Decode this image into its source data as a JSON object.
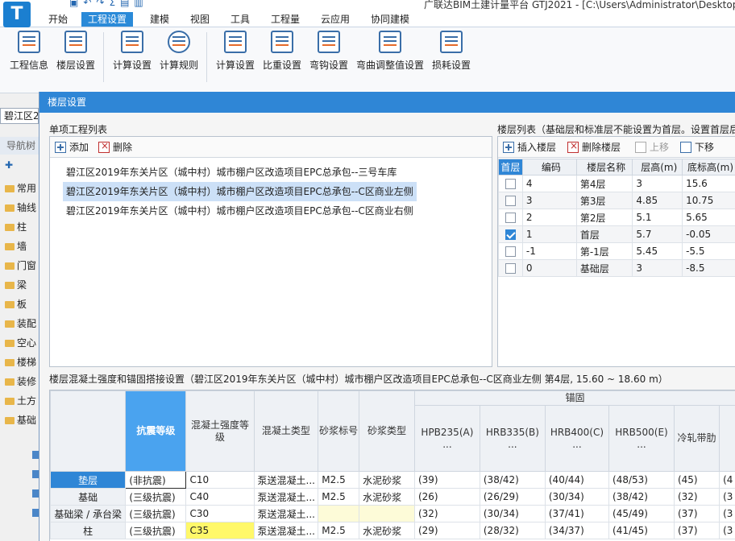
{
  "app": {
    "logo": "T",
    "title": "广联达BIM土建计量平台 GTJ2021 - [C:\\Users\\Administrator\\Desktop"
  },
  "menu": {
    "tabs": [
      "开始",
      "工程设置",
      "建模",
      "视图",
      "工具",
      "工程量",
      "云应用",
      "协同建模"
    ]
  },
  "ribbon": {
    "buttons": [
      "工程信息",
      "楼层设置",
      "计算设置",
      "计算规则",
      "计算设置",
      "比重设置",
      "弯钩设置",
      "弯曲调整值设置",
      "损耗设置"
    ]
  },
  "main": {
    "project_select": "碧江区2",
    "nav_title": "导航树",
    "nav_items": [
      "常用",
      "轴线",
      "柱",
      "墙",
      "门窗",
      "梁",
      "板",
      "装配",
      "空心",
      "楼梯",
      "装修",
      "土方",
      "基础"
    ]
  },
  "dialog": {
    "title": "楼层设置",
    "project_list_label": "单项工程列表",
    "add_label": "添加",
    "delete_label": "删除",
    "projects": [
      "碧江区2019年东关片区（城中村）城市棚户区改造项目EPC总承包--三号车库",
      "碧江区2019年东关片区（城中村）城市棚户区改造项目EPC总承包--C区商业左侧",
      "碧江区2019年东关片区（城中村）城市棚户区改造项目EPC总承包--C区商业右侧"
    ],
    "floor_list_label": "楼层列表（基础层和标准层不能设置为首层。设置首层后",
    "floor_toolbar": {
      "insert": "插入楼层",
      "delete": "删除楼层",
      "up": "上移",
      "down": "下移"
    },
    "floor_headers": [
      "首层",
      "编码",
      "楼层名称",
      "层高(m)",
      "底标高(m)"
    ],
    "floors": [
      {
        "checked": false,
        "code": "4",
        "name": "第4层",
        "height": "3",
        "bottom": "15.6"
      },
      {
        "checked": false,
        "code": "3",
        "name": "第3层",
        "height": "4.85",
        "bottom": "10.75"
      },
      {
        "checked": false,
        "code": "2",
        "name": "第2层",
        "height": "5.1",
        "bottom": "5.65"
      },
      {
        "checked": true,
        "code": "1",
        "name": "首层",
        "height": "5.7",
        "bottom": "-0.05"
      },
      {
        "checked": false,
        "code": "-1",
        "name": "第-1层",
        "height": "5.45",
        "bottom": "-5.5"
      },
      {
        "checked": false,
        "code": "0",
        "name": "基础层",
        "height": "3",
        "bottom": "-8.5"
      }
    ],
    "concrete_label": "楼层混凝土强度和锚固搭接设置（碧江区2019年东关片区（城中村）城市棚户区改造项目EPC总承包--C区商业左侧 第4层, 15.60 ~ 18.60 m）",
    "concrete_group_header": "锚固",
    "concrete_headers": [
      "抗震等级",
      "混凝土强度等级",
      "混凝土类型",
      "砂浆标号",
      "砂浆类型",
      "HPB235(A)",
      "HRB335(B)",
      "HRB400(C)",
      "HRB500(E)",
      "冷轧带肋"
    ],
    "ellipsis": "...",
    "concrete_rows": [
      {
        "name": "垫层",
        "seismic": "(非抗震)",
        "grade": "C10",
        "ctype": "泵送混凝土...",
        "mortar": "M2.5",
        "mtype": "水泥砂浆",
        "a": "(39)",
        "b": "(38/42)",
        "c": "(40/44)",
        "e": "(48/53)",
        "cold": "(45)",
        "extra": "(4"
      },
      {
        "name": "基础",
        "seismic": "(三级抗震)",
        "grade": "C40",
        "ctype": "泵送混凝土...",
        "mortar": "M2.5",
        "mtype": "水泥砂浆",
        "a": "(26)",
        "b": "(26/29)",
        "c": "(30/34)",
        "e": "(38/42)",
        "cold": "(32)",
        "extra": "(3"
      },
      {
        "name": "基础梁 / 承台梁",
        "seismic": "(三级抗震)",
        "grade": "C30",
        "ctype": "泵送混凝土...",
        "mortar": "",
        "mtype": "",
        "a": "(32)",
        "b": "(30/34)",
        "c": "(37/41)",
        "e": "(45/49)",
        "cold": "(37)",
        "extra": "(3"
      },
      {
        "name": "柱",
        "seismic": "(三级抗震)",
        "grade": "C35",
        "ctype": "泵送混凝土...",
        "mortar": "M2.5",
        "mtype": "水泥砂浆",
        "a": "(29)",
        "b": "(28/32)",
        "c": "(34/37)",
        "e": "(41/45)",
        "cold": "(37)",
        "extra": "(3"
      }
    ]
  },
  "colors": {
    "accent": "#2f86d6",
    "selected_row": "#cce0f7",
    "highlight_yellow": "#fff86a"
  }
}
